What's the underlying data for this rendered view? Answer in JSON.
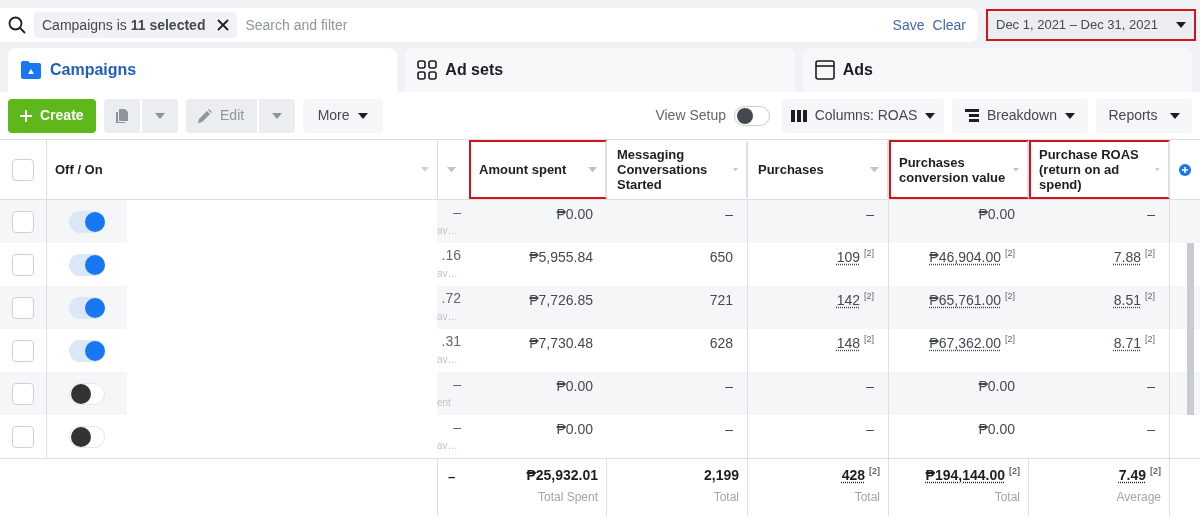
{
  "filter_bar": {
    "chip_prefix": "Campaigns is ",
    "chip_bold": "11 selected",
    "placeholder": "Search and filter",
    "save": "Save",
    "clear": "Clear"
  },
  "date_range": {
    "label": "Dec 1, 2021 – Dec 31, 2021",
    "highlighted": true
  },
  "tabs": [
    {
      "label": "Campaigns",
      "kind": "folder",
      "selected": true
    },
    {
      "label": "Ad sets",
      "kind": "grid",
      "selected": false
    },
    {
      "label": "Ads",
      "kind": "window",
      "selected": false
    }
  ],
  "toolbar": {
    "create": "Create",
    "edit": "Edit",
    "more": "More",
    "view_setup": "View Setup",
    "view_setup_on": false,
    "columns": "Columns: ROAS",
    "breakdown": "Breakdown",
    "reports": "Reports"
  },
  "table": {
    "off_on_header": "Off / On",
    "header_checked": false,
    "columns": [
      {
        "label": "Amount spent",
        "highlighted": true
      },
      {
        "label": "Messaging Conversations Started",
        "highlighted": false
      },
      {
        "label": "Purchases",
        "highlighted": false
      },
      {
        "label": "Purchases conversion value",
        "highlighted": true
      },
      {
        "label": "Purchase ROAS (return on ad spend)",
        "highlighted": true
      }
    ],
    "rows": [
      {
        "checked": false,
        "on": true,
        "column_1": {
          "value": "–",
          "note": "av…"
        },
        "cells": [
          {
            "value": "₱0.00"
          },
          {
            "value": "–"
          },
          {
            "value": "–"
          },
          {
            "value": "₱0.00"
          },
          {
            "value": "–"
          }
        ]
      },
      {
        "checked": false,
        "on": true,
        "column_1": {
          "value": ".16",
          "note": "av…"
        },
        "cells": [
          {
            "value": "₱5,955.84"
          },
          {
            "value": "650"
          },
          {
            "value": "109",
            "footnote": "[2]"
          },
          {
            "value": "₱46,904.00",
            "footnote": "[2]"
          },
          {
            "value": "7.88",
            "footnote": "[2]"
          }
        ]
      },
      {
        "checked": false,
        "on": true,
        "column_1": {
          "value": ".72",
          "note": "av…"
        },
        "cells": [
          {
            "value": "₱7,726.85"
          },
          {
            "value": "721"
          },
          {
            "value": "142",
            "footnote": "[2]"
          },
          {
            "value": "₱65,761.00",
            "footnote": "[2]"
          },
          {
            "value": "8.51",
            "footnote": "[2]"
          }
        ]
      },
      {
        "checked": false,
        "on": true,
        "column_1": {
          "value": ".31",
          "note": "av…"
        },
        "cells": [
          {
            "value": "₱7,730.48"
          },
          {
            "value": "628"
          },
          {
            "value": "148",
            "footnote": "[2]"
          },
          {
            "value": "₱67,362.00",
            "footnote": "[2]"
          },
          {
            "value": "8.71",
            "footnote": "[2]"
          }
        ]
      },
      {
        "checked": false,
        "on": false,
        "column_1": {
          "value": "–",
          "note": "ent"
        },
        "cells": [
          {
            "value": "₱0.00"
          },
          {
            "value": "–"
          },
          {
            "value": "–"
          },
          {
            "value": "₱0.00"
          },
          {
            "value": "–"
          }
        ]
      },
      {
        "checked": false,
        "on": false,
        "column_1": {
          "value": "–",
          "note": "av…"
        },
        "cells": [
          {
            "value": "₱0.00"
          },
          {
            "value": "–"
          },
          {
            "value": "–"
          },
          {
            "value": "₱0.00"
          },
          {
            "value": "–"
          }
        ]
      }
    ],
    "totals": {
      "column_1": "–",
      "cells": [
        {
          "value": "₱25,932.01",
          "label": "Total Spent"
        },
        {
          "value": "2,199",
          "label": "Total"
        },
        {
          "value": "428",
          "footnote": "[2]",
          "label": "Total"
        },
        {
          "value": "₱194,144.00",
          "footnote": "[2]",
          "label": "Total"
        },
        {
          "value": "7.49",
          "footnote": "[2]",
          "label": "Average"
        }
      ]
    }
  }
}
